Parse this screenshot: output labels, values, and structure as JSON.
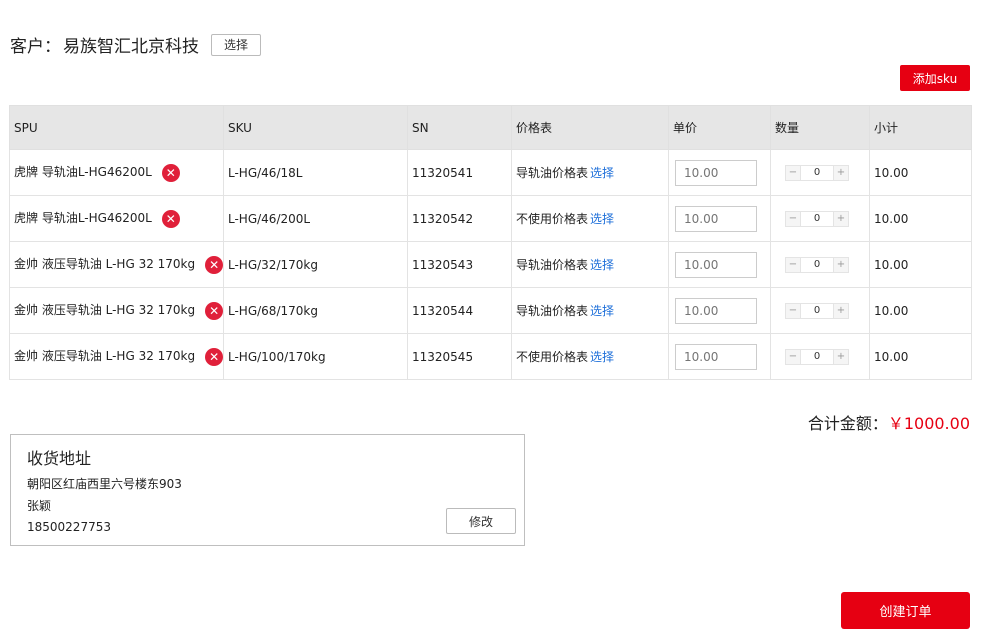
{
  "customer": {
    "label": "客户：",
    "name": "易族智汇北京科技",
    "select_label": "选择"
  },
  "toolbar": {
    "add_sku_label": "添加sku"
  },
  "table": {
    "columns": [
      "SPU",
      "SKU",
      "SN",
      "价格表",
      "单价",
      "数量",
      "小计"
    ],
    "select_link": "选择",
    "rows": [
      {
        "spu": "虎牌 导轨油L-HG46200L",
        "sku": "L-HG/46/18L",
        "sn": "11320541",
        "price_table": "导轨油价格表",
        "unit_price": "10.00",
        "qty": "0",
        "subtotal": "10.00"
      },
      {
        "spu": "虎牌 导轨油L-HG46200L",
        "sku": "L-HG/46/200L",
        "sn": "11320542",
        "price_table": "不使用价格表",
        "unit_price": "10.00",
        "qty": "0",
        "subtotal": "10.00"
      },
      {
        "spu": "金帅 液压导轨油 L-HG 32 170kg",
        "sku": "L-HG/32/170kg",
        "sn": "11320543",
        "price_table": "导轨油价格表",
        "unit_price": "10.00",
        "qty": "0",
        "subtotal": "10.00"
      },
      {
        "spu": "金帅 液压导轨油 L-HG 32 170kg",
        "sku": "L-HG/68/170kg",
        "sn": "11320544",
        "price_table": "导轨油价格表",
        "unit_price": "10.00",
        "qty": "0",
        "subtotal": "10.00"
      },
      {
        "spu": "金帅 液压导轨油 L-HG 32 170kg",
        "sku": "L-HG/100/170kg",
        "sn": "11320545",
        "price_table": "不使用价格表",
        "unit_price": "10.00",
        "qty": "0",
        "subtotal": "10.00"
      }
    ]
  },
  "total": {
    "label": "合计金额：",
    "value": "￥1000.00"
  },
  "address": {
    "title": "收货地址",
    "street": "朝阳区红庙西里六号楼东903",
    "name": "张颖",
    "phone": "18500227753",
    "edit_label": "修改"
  },
  "footer": {
    "create_order_label": "创建订单"
  },
  "icons": {
    "remove": "close-circle-icon",
    "minus": "minus-icon",
    "plus": "plus-icon"
  },
  "colors": {
    "accent": "#e60012",
    "link": "#1e6fd9",
    "remove_icon": "#e0203a"
  }
}
